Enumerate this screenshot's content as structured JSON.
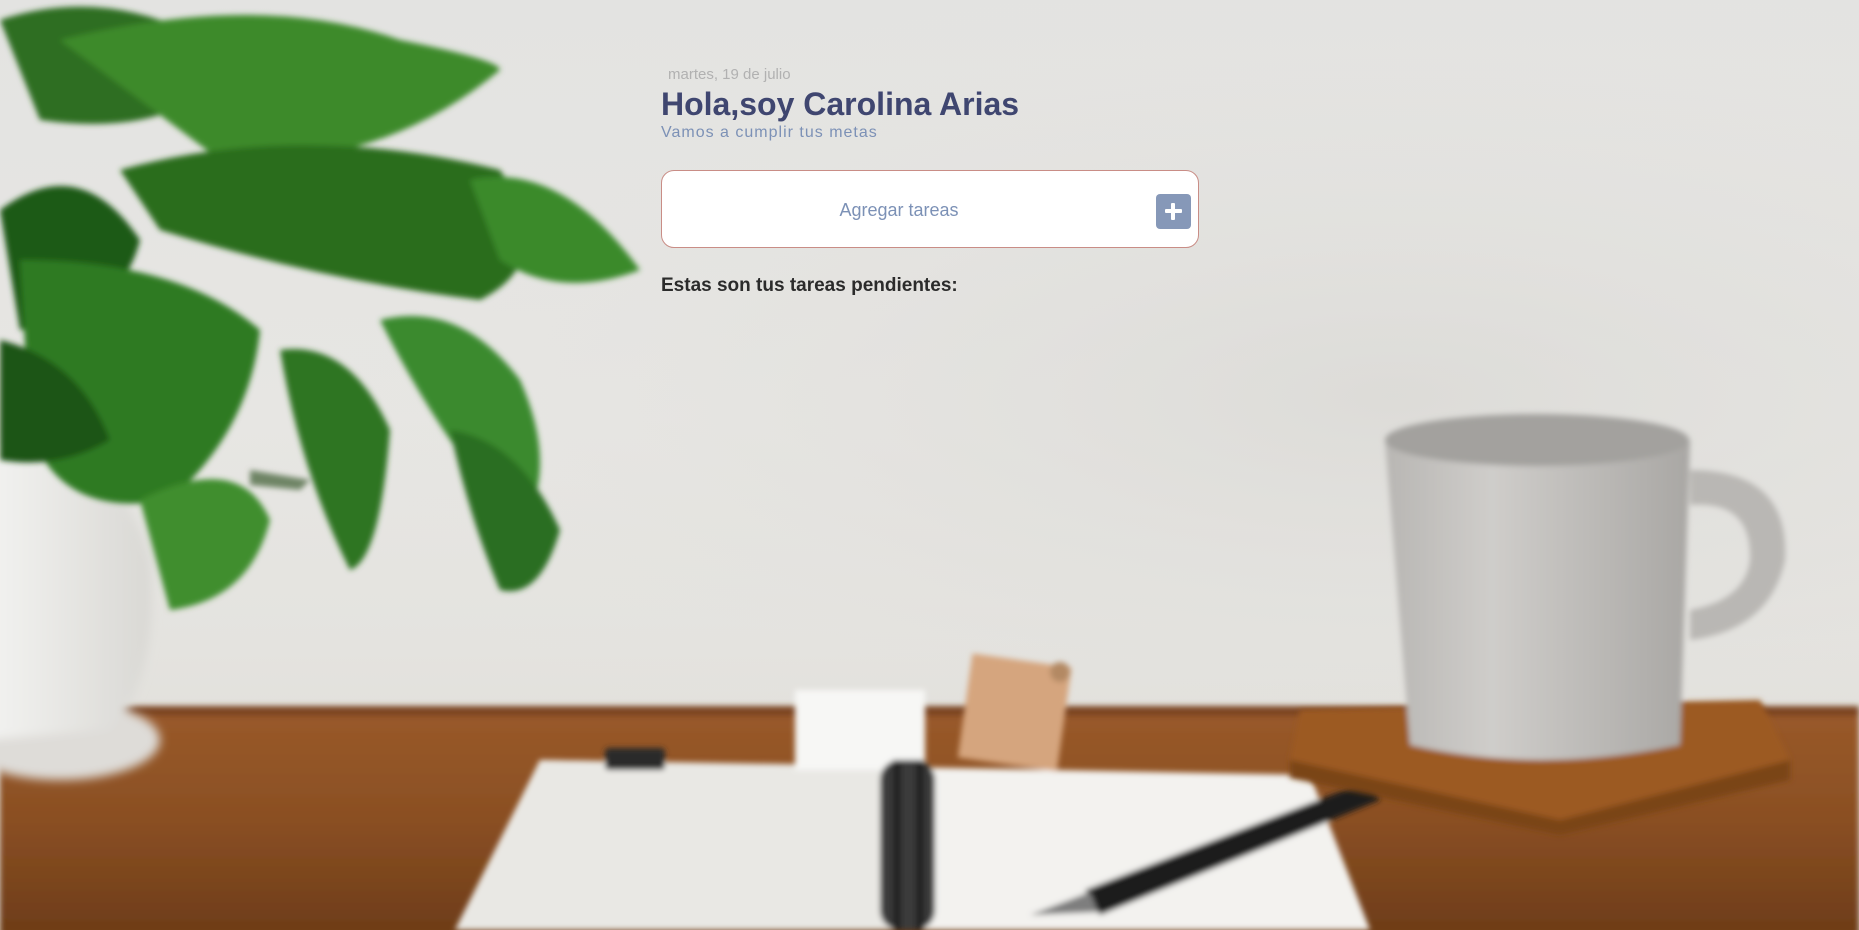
{
  "header": {
    "date": "martes, 19 de julio",
    "greeting": "Hola,soy Carolina Arias",
    "subtitle": "Vamos a cumplir tus metas"
  },
  "task_input": {
    "placeholder": "Agregar tareas",
    "value": "",
    "add_button_icon": "plus-icon"
  },
  "tasks": {
    "heading": "Estas son tus tareas pendientes:",
    "items": []
  },
  "colors": {
    "title": "#3f4670",
    "subtitle": "#7c91b6",
    "add_button": "#8698b8",
    "task_box_border": "#c98d86"
  }
}
